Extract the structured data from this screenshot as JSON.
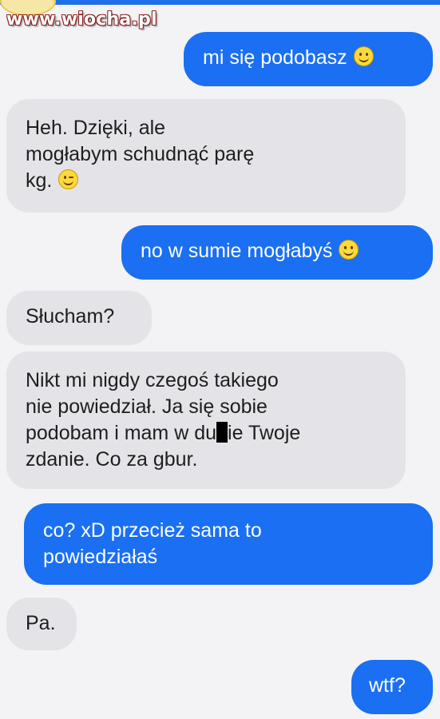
{
  "watermark": "www.wiocha.pl",
  "colors": {
    "sent_bubble": "#1a6ff2",
    "received_bubble": "#e4e4e8",
    "background": "#f3f3f5"
  },
  "messages": [
    {
      "side": "sent",
      "text": "mi się podobasz",
      "icon": "smiley-icon"
    },
    {
      "side": "received",
      "lines": [
        "Heh. Dzięki, ale",
        "mogłabym schudnąć parę",
        "kg."
      ],
      "icon": "wink-icon"
    },
    {
      "side": "sent",
      "text": "no w sumie mogłabyś",
      "icon": "smiley-icon"
    },
    {
      "side": "received",
      "text": "Słucham?"
    },
    {
      "side": "received",
      "lines": [
        "Nikt mi nigdy czegoś takiego",
        "nie powiedział. Ja się sobie",
        "podobam i mam w du",
        "ie Twoje",
        "zdanie. Co za gbur."
      ]
    },
    {
      "side": "sent",
      "lines": [
        "co? xD przecież sama to",
        "powiedziałaś"
      ]
    },
    {
      "side": "received",
      "text": "Pa."
    },
    {
      "side": "sent",
      "text": "wtf?"
    }
  ]
}
